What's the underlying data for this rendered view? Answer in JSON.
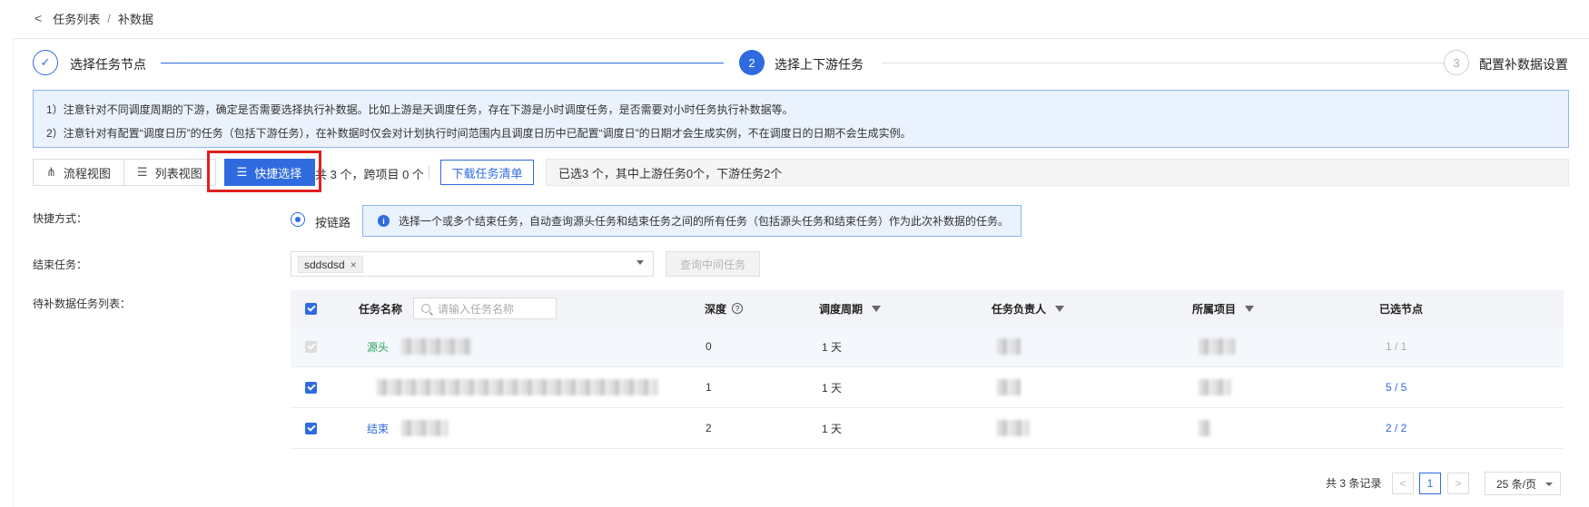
{
  "breadcrumb": {
    "parent": "任务列表",
    "separator": "/",
    "current": "补数据"
  },
  "steps": [
    {
      "label": "选择任务节点",
      "status": "done"
    },
    {
      "label": "选择上下游任务",
      "status": "active",
      "number": "2"
    },
    {
      "label": "配置补数据设置",
      "status": "wait",
      "number": "3"
    }
  ],
  "notice": {
    "line1": "1）注意针对不同调度周期的下游，确定是否需要选择执行补数据。比如上游是天调度任务，存在下游是小时调度任务，是否需要对小时任务执行补数据等。",
    "line2": "2）注意针对有配置“调度日历”的任务（包括下游任务），在补数据时仅会对计划执行时间范围内且调度日历中已配置“调度日”的日期才会生成实例，不在调度日的日期不会生成实例。"
  },
  "toolbar": {
    "view_flow": "流程视图",
    "view_list": "列表视图",
    "quick_select": "快捷选择",
    "summary": "共 3 个，跨项目 0 个",
    "download": "下载任务清单",
    "selected_info": "已选3 个，其中上游任务0个，下游任务2个"
  },
  "form": {
    "method_label": "快捷方式：",
    "method_option": "按链路",
    "method_hint": "选择一个或多个结束任务，自动查询源头任务和结束任务之间的所有任务（包括源头任务和结束任务）作为此次补数据的任务。",
    "end_task_label": "结束任务：",
    "end_task_tag": "sddsdsd",
    "query_button": "查询中间任务",
    "list_label": "待补数据任务列表："
  },
  "table": {
    "headers": {
      "name": "任务名称",
      "search_placeholder": "请输入任务名称",
      "depth": "深度",
      "cycle": "调度周期",
      "owner": "任务负责人",
      "project": "所属项目",
      "nodes": "已选节点"
    },
    "rows": [
      {
        "tag": "源头",
        "depth": "0",
        "cycle": "1 天",
        "nodes": "1 / 1",
        "checked": true,
        "disabled": true
      },
      {
        "tag": "",
        "depth": "1",
        "cycle": "1 天",
        "nodes": "5 / 5",
        "checked": true,
        "disabled": false
      },
      {
        "tag": "结束",
        "depth": "2",
        "cycle": "1 天",
        "nodes": "2 / 2",
        "checked": true,
        "disabled": false
      }
    ]
  },
  "pagination": {
    "total": "共 3 条记录",
    "current_page": "1",
    "page_size": "25 条/页"
  },
  "colors": {
    "primary": "#2f6bdf",
    "source_tag": "#2aa35a",
    "highlight": "#e02020",
    "notice_bg": "#eaf2fd"
  }
}
